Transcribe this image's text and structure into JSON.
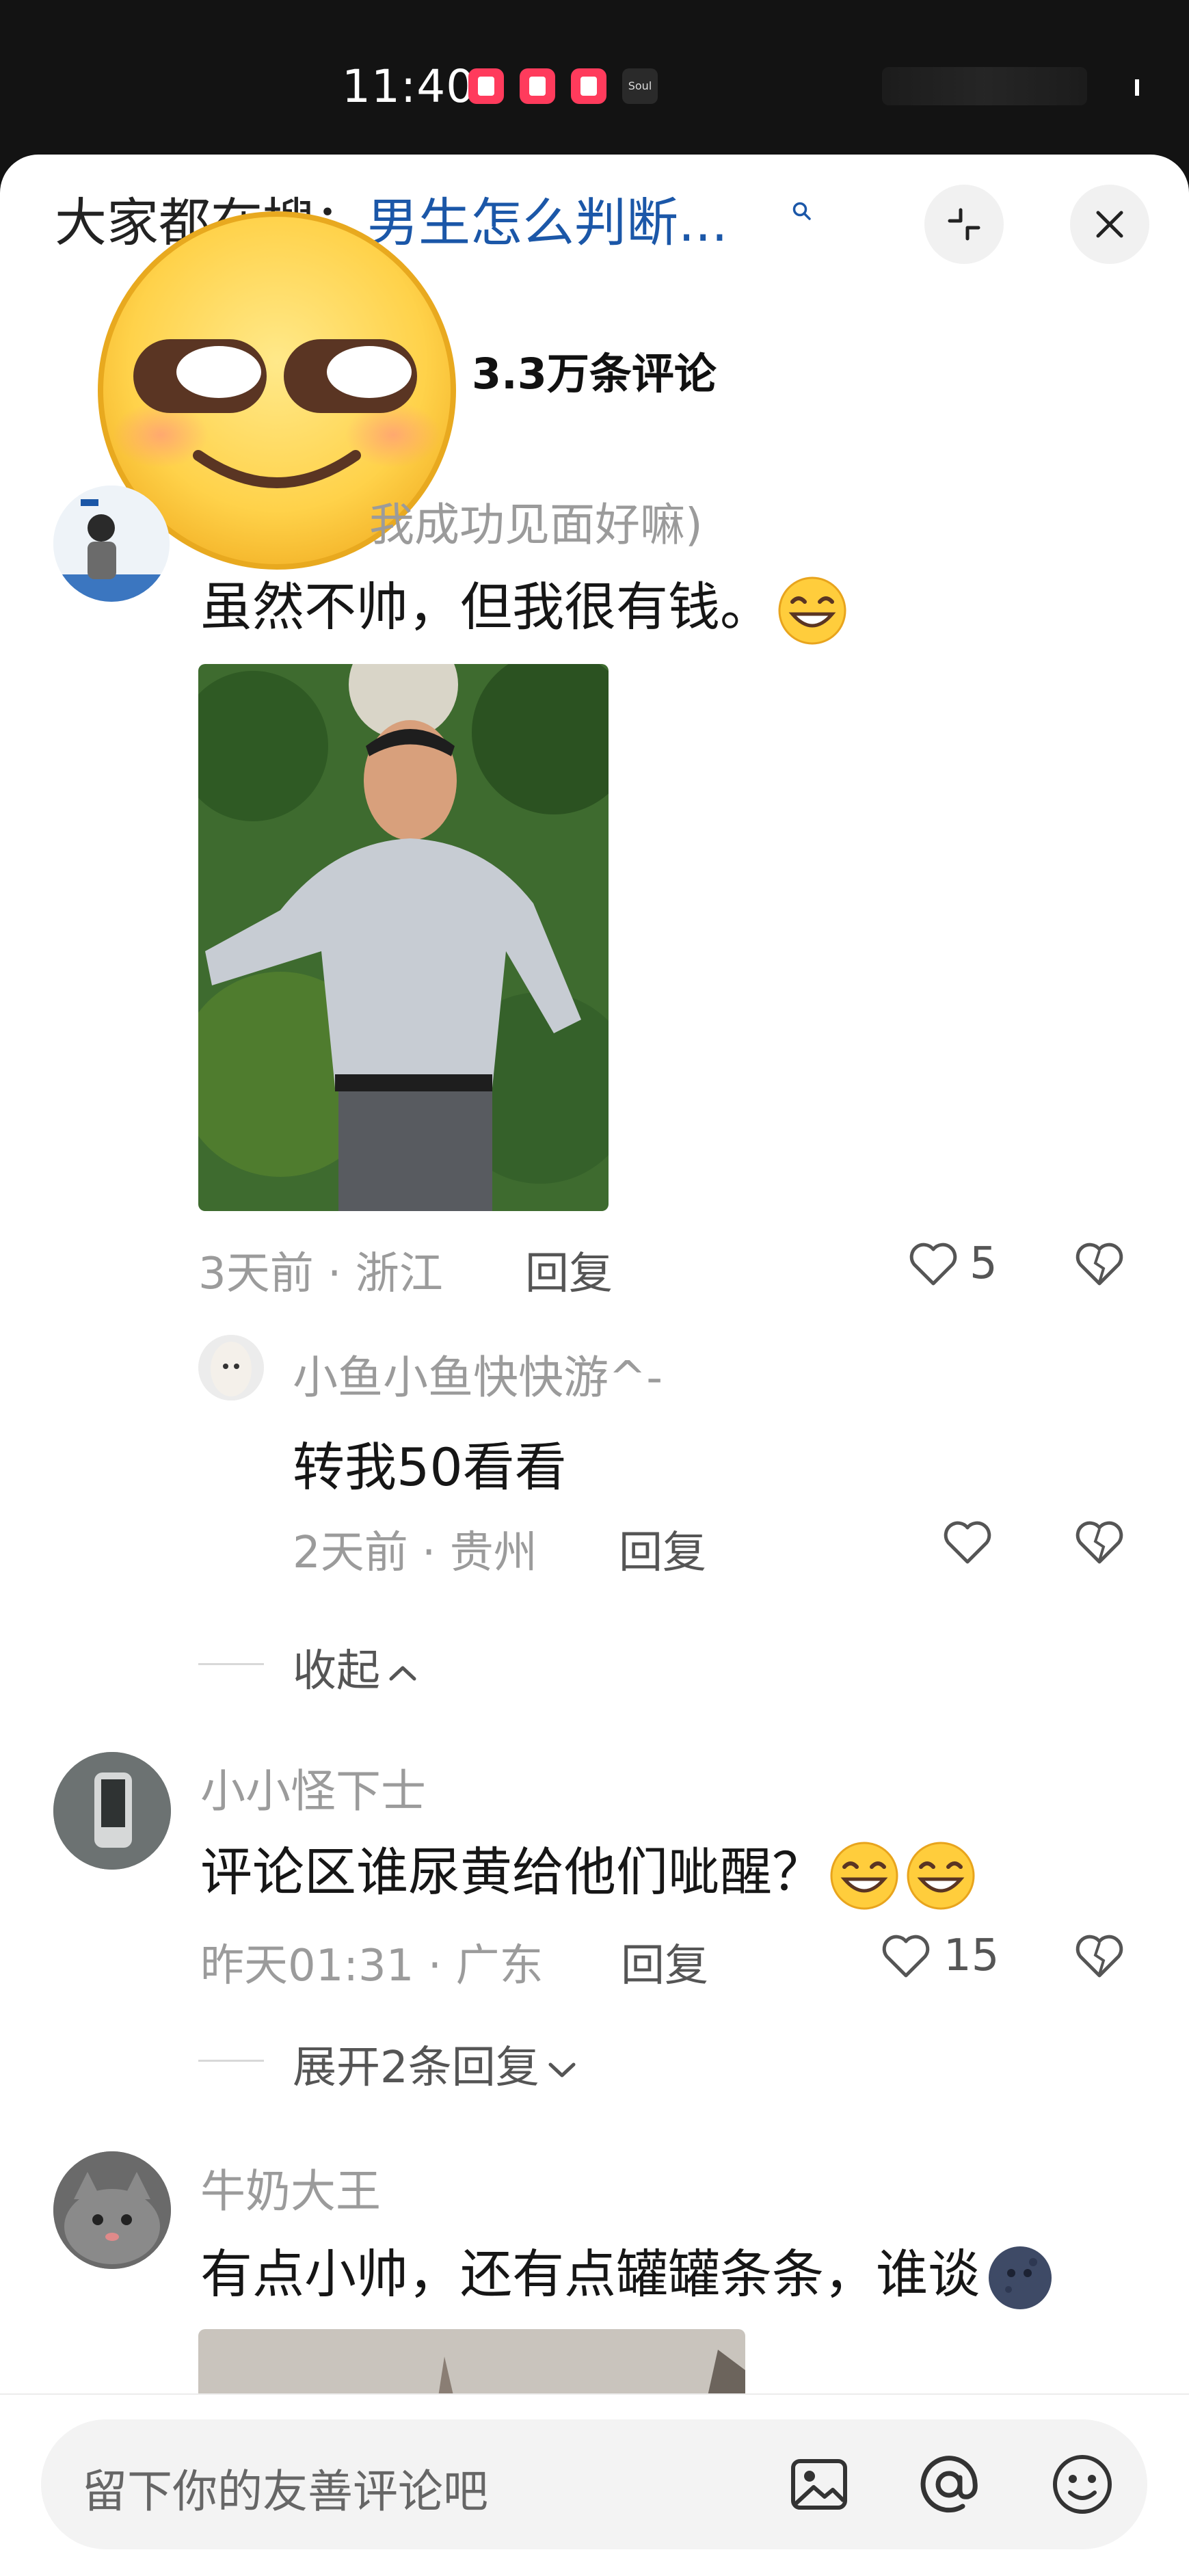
{
  "status_bar": {
    "time": "11:40",
    "app2_label": "Soul"
  },
  "header": {
    "search_prefix": "大家都在搜：",
    "search_query": "男生怎么判断...",
    "comment_count": "3.3万条评论"
  },
  "comments": [
    {
      "username": "我成功见面好嘛)",
      "text": "虽然不帅，但我很有钱。",
      "time_loc": "3天前 · 浙江",
      "reply": "回复",
      "likes": "5",
      "replies": [
        {
          "username": "小鱼小鱼快快游^-",
          "text": "转我50看看",
          "time_loc": "2天前 · 贵州",
          "reply": "回复"
        }
      ],
      "collapse": "收起"
    },
    {
      "username": "小小怪下士",
      "text": "评论区谁尿黄给他们呲醒？",
      "time_loc": "昨天01:31 · 广东",
      "reply": "回复",
      "likes": "15",
      "expand": "展开2条回复"
    },
    {
      "username": "牛奶大王",
      "text": "有点小帅，还有点罐罐条条，谁谈"
    }
  ],
  "bottom_bar": {
    "placeholder": "留下你的友善评论吧"
  },
  "icons": {
    "search": "search-icon",
    "shrink": "shrink-icon",
    "close": "close-icon",
    "heart": "heart-icon",
    "dislike": "broken-heart-icon",
    "image": "image-icon",
    "at": "at-icon",
    "emoji": "emoji-icon"
  },
  "colors": {
    "accent_link": "#1b57a8",
    "meta_gray": "#9b9b9b",
    "status_bar": "#131313"
  }
}
